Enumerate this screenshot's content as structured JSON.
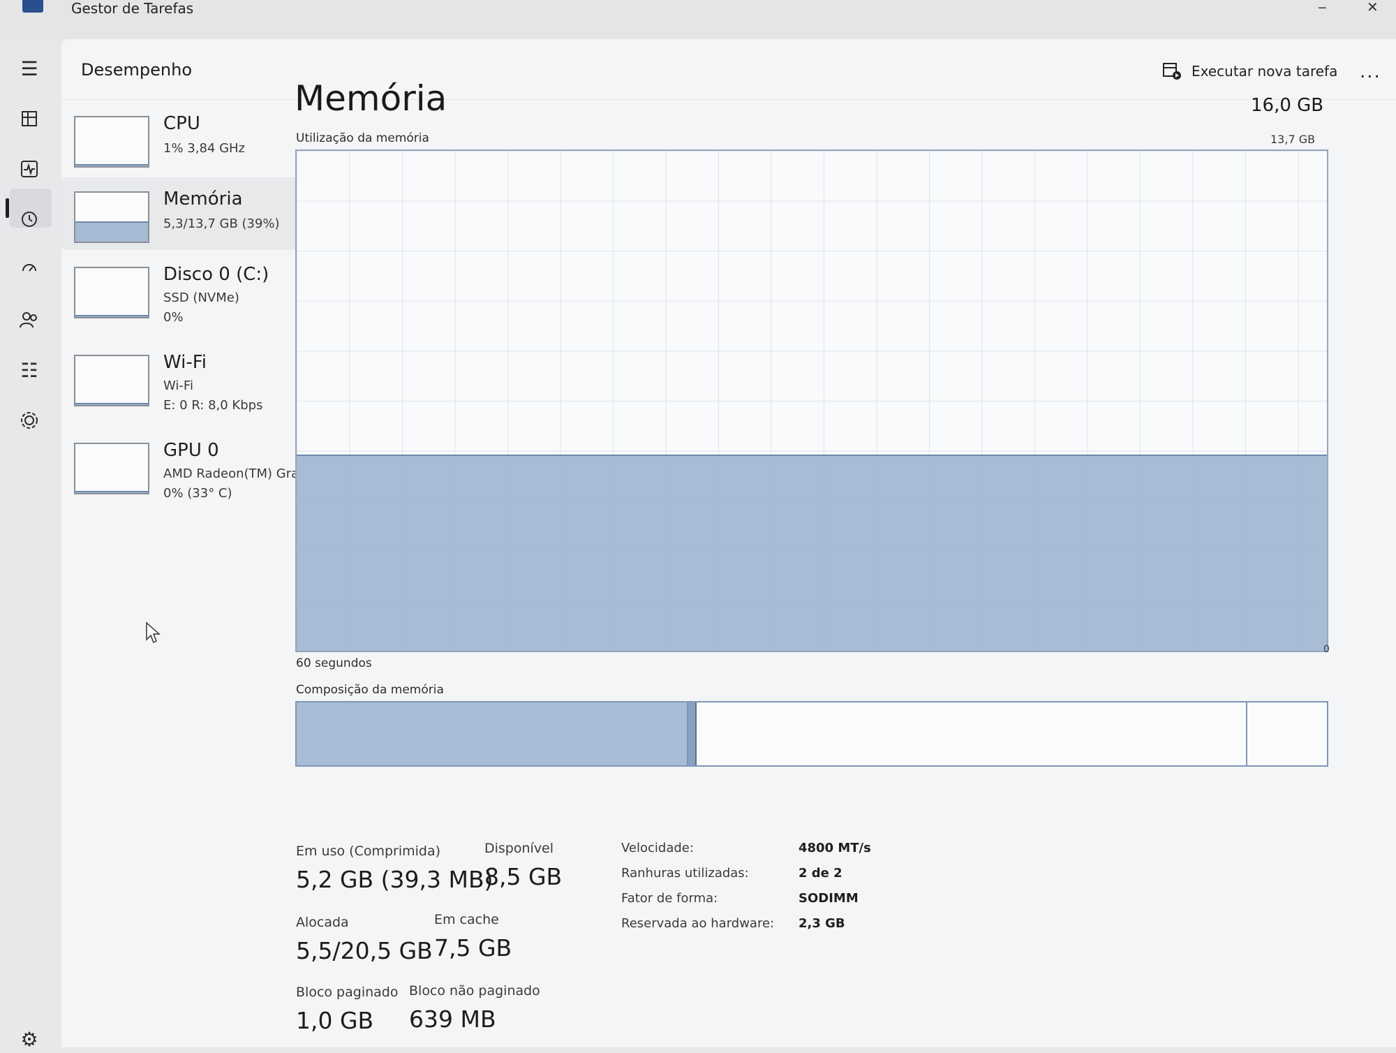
{
  "window": {
    "title": "Gestor de Tarefas"
  },
  "header": {
    "title": "Desempenho",
    "run_task_label": "Executar nova tarefa",
    "more_label": "..."
  },
  "nav_icons": [
    "hamburger-icon",
    "processes-icon",
    "performance-icon",
    "app-history-icon",
    "startup-apps-icon",
    "users-icon",
    "details-icon",
    "services-icon",
    "settings-icon"
  ],
  "devices": [
    {
      "name": "CPU",
      "sub1": "1% 3,84 GHz",
      "sub2": "",
      "level": 0.01
    },
    {
      "name": "Memória",
      "sub1": "5,3/13,7 GB (39%)",
      "sub2": "",
      "level": 0.39
    },
    {
      "name": "Disco 0 (C:)",
      "sub1": "SSD (NVMe)",
      "sub2": "0%",
      "level": 0.0
    },
    {
      "name": "Wi-Fi",
      "sub1": "Wi-Fi",
      "sub2": "E: 0 R: 8,0 Kbps",
      "level": 0.02
    },
    {
      "name": "GPU 0",
      "sub1": "AMD Radeon(TM) Gra...",
      "sub2": "0% (33° C)",
      "level": 0.02
    }
  ],
  "memory": {
    "title": "Memória",
    "total": "16,0 GB",
    "usage_label": "Utilização da memória",
    "usage_max": "13,7 GB",
    "graph_time_label": "60 segundos",
    "graph_min_label": "0",
    "usage_fraction": 0.39,
    "composition_label": "Composição da memória",
    "composition": {
      "in_use": 0.38,
      "modified": 0.008,
      "standby": 0.535,
      "free": 0.077
    },
    "stats": {
      "in_use_label": "Em uso (Comprimida)",
      "in_use_value": "5,2 GB (39,3 MB)",
      "available_label": "Disponível",
      "available_value": "8,5 GB",
      "committed_label": "Alocada",
      "committed_value": "5,5/20,5 GB",
      "cached_label": "Em cache",
      "cached_value": "7,5 GB",
      "paged_pool_label": "Bloco paginado",
      "paged_pool_value": "1,0 GB",
      "nonpaged_pool_label": "Bloco não paginado",
      "nonpaged_pool_value": "639 MB"
    },
    "details": [
      {
        "key": "Velocidade:",
        "value": "4800 MT/s"
      },
      {
        "key": "Ranhuras utilizadas:",
        "value": "2 de 2"
      },
      {
        "key": "Fator de forma:",
        "value": "SODIMM"
      },
      {
        "key": "Reservada ao hardware:",
        "value": "2,3 GB"
      }
    ]
  }
}
